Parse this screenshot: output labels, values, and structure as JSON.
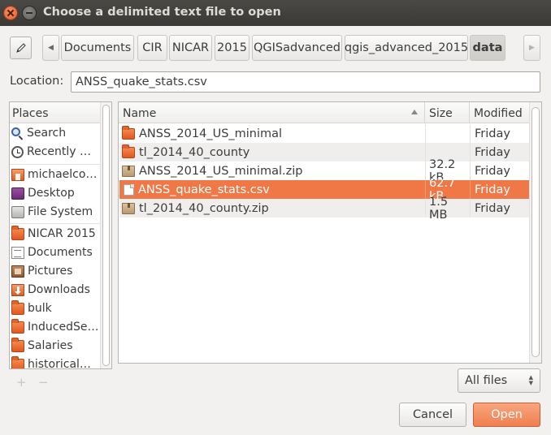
{
  "window": {
    "title": "Choose a delimited text file to open",
    "close_icon": "close-icon",
    "minimize_icon": "minimize-icon"
  },
  "pathbar": {
    "edit_icon": "pencil-icon",
    "left_arrow": "◀",
    "right_arrow": "▶",
    "crumbs": [
      "Documents",
      "CIR",
      "NICAR",
      "2015",
      "QGISadvanced",
      "qgis_advanced_2015",
      "data"
    ],
    "active_crumb": "data"
  },
  "location": {
    "label": "Location:",
    "value": "ANSS_quake_stats.csv"
  },
  "places": {
    "header": "Places",
    "items": [
      {
        "label": "Search",
        "icon": "search-icon"
      },
      {
        "label": "Recently …",
        "icon": "recent-icon"
      },
      {
        "label": "michaelco…",
        "icon": "home-folder-icon"
      },
      {
        "label": "Desktop",
        "icon": "desktop-icon"
      },
      {
        "label": "File System",
        "icon": "filesystem-icon"
      },
      {
        "label": "NICAR 2015",
        "icon": "folder-icon"
      },
      {
        "label": "Documents",
        "icon": "documents-icon"
      },
      {
        "label": "Pictures",
        "icon": "pictures-icon"
      },
      {
        "label": "Downloads",
        "icon": "downloads-icon"
      },
      {
        "label": "bulk",
        "icon": "folder-icon"
      },
      {
        "label": "InducedSe…",
        "icon": "folder-icon"
      },
      {
        "label": "Salaries",
        "icon": "folder-icon"
      },
      {
        "label": "historical…",
        "icon": "folder-icon"
      }
    ],
    "add_label": "+",
    "remove_label": "−"
  },
  "files": {
    "columns": {
      "name": "Name",
      "size": "Size",
      "modified": "Modified"
    },
    "rows": [
      {
        "name": "ANSS_2014_US_minimal",
        "size": "",
        "modified": "Friday",
        "icon": "folder-icon",
        "selected": false
      },
      {
        "name": "tl_2014_40_county",
        "size": "",
        "modified": "Friday",
        "icon": "folder-icon",
        "selected": false
      },
      {
        "name": "ANSS_2014_US_minimal.zip",
        "size": "32.2 kB",
        "modified": "Friday",
        "icon": "zip-icon",
        "selected": false
      },
      {
        "name": "ANSS_quake_stats.csv",
        "size": "62.7 kB",
        "modified": "Friday",
        "icon": "text-file-icon",
        "selected": true
      },
      {
        "name": "tl_2014_40_county.zip",
        "size": "1.5 MB",
        "modified": "Friday",
        "icon": "zip-icon",
        "selected": false
      }
    ]
  },
  "filter": {
    "selected": "All files"
  },
  "buttons": {
    "cancel": "Cancel",
    "open": "Open"
  },
  "colors": {
    "accent": "#f07746",
    "titlebar": "#3c3b37"
  }
}
